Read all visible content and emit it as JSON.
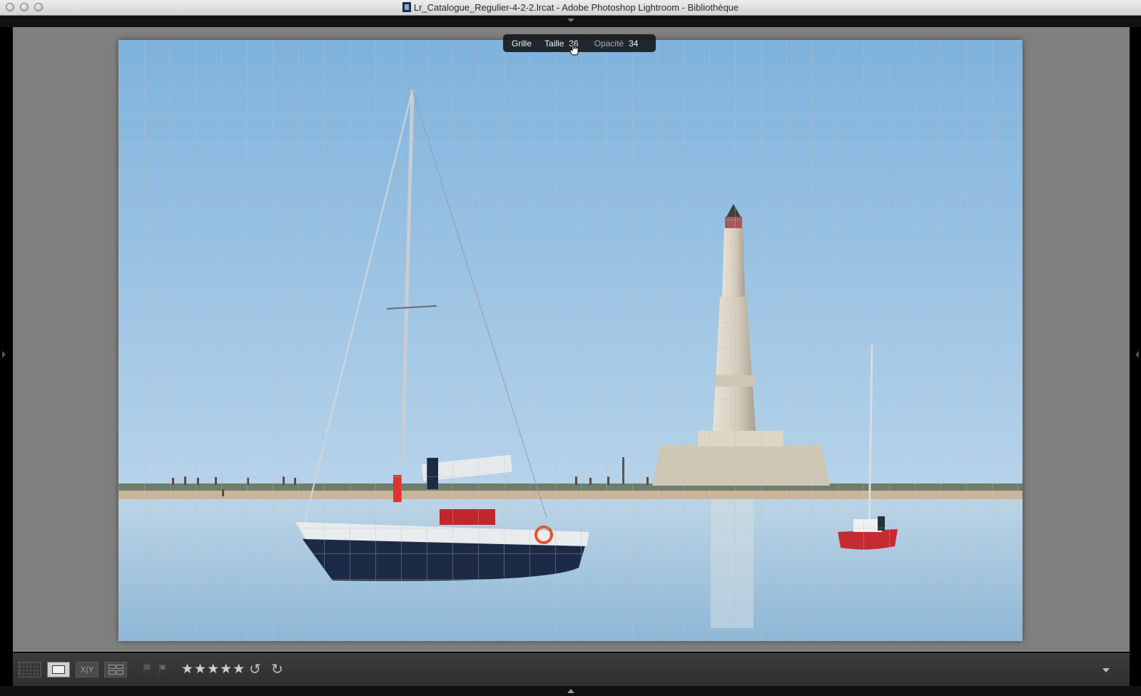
{
  "window": {
    "title": "Lr_Catalogue_Regulier-4-2-2.lrcat - Adobe Photoshop Lightroom - Bibliothèque"
  },
  "hud": {
    "grid_label": "Grille",
    "size_label": "Taille",
    "size_value": "36",
    "opacity_label": "Opacité",
    "opacity_value": "34"
  },
  "photo": {
    "content": [
      "sailboat",
      "lighthouse",
      "small-red-sailboat",
      "beach",
      "sea",
      "sky"
    ],
    "grid_overlay": true,
    "overlay_color": "#bebebe"
  },
  "toolbar": {
    "view_buttons": [
      "grid-view-icon",
      "loupe-view-icon",
      "compare-view-icon",
      "survey-view-icon"
    ],
    "compare_label": "X|Y",
    "stars": "★★★★★",
    "rotate_left": "↺",
    "rotate_right": "↻",
    "active_view": "loupe"
  },
  "colors": {
    "main_bg": "#7f7f7f",
    "toolbar_bg": "#353535",
    "sky": "#8fbbdf",
    "sea": "#a9cae0"
  }
}
